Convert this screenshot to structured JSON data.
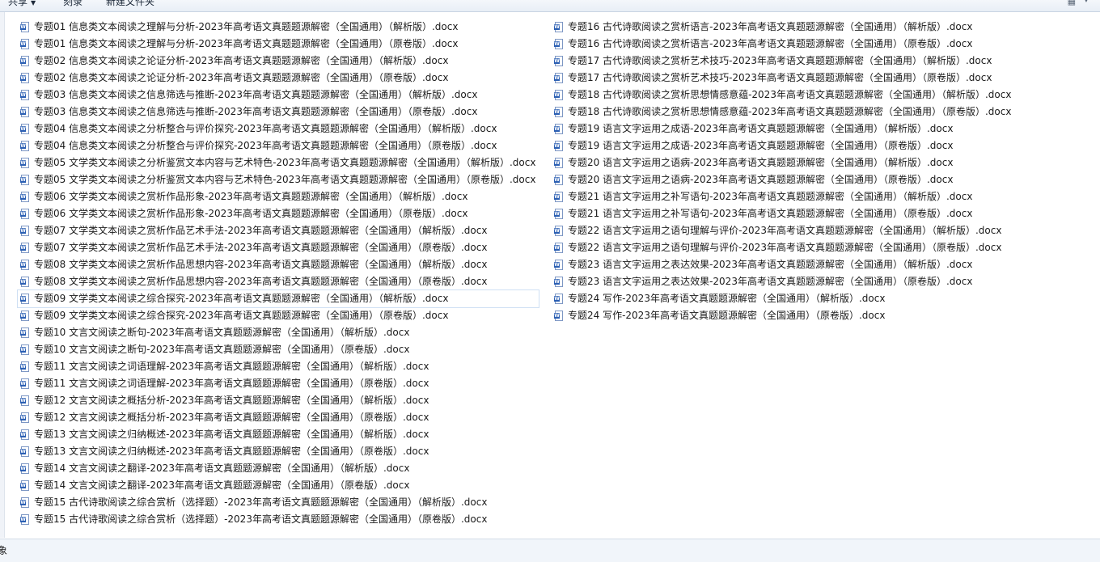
{
  "toolbar": {
    "share_label": "共享",
    "burn_label": "刻录",
    "new_folder_label": "新建文件夹",
    "view_icon": "view-options-icon",
    "view_caret_icon": "chevron-down-icon"
  },
  "file_icon": "word-document-icon",
  "files_left": [
    "专题01 信息类文本阅读之理解与分析-2023年高考语文真题题源解密（全国通用）（解析版）.docx",
    "专题01 信息类文本阅读之理解与分析-2023年高考语文真题题源解密（全国通用）（原卷版）.docx",
    "专题02 信息类文本阅读之论证分析-2023年高考语文真题题源解密（全国通用）（解析版）.docx",
    "专题02 信息类文本阅读之论证分析-2023年高考语文真题题源解密（全国通用）（原卷版）.docx",
    "专题03 信息类文本阅读之信息筛选与推断-2023年高考语文真题题源解密（全国通用）（解析版）.docx",
    "专题03 信息类文本阅读之信息筛选与推断-2023年高考语文真题题源解密（全国通用）（原卷版）.docx",
    "专题04 信息类文本阅读之分析整合与评价探究-2023年高考语文真题题源解密（全国通用）（解析版）.docx",
    "专题04 信息类文本阅读之分析整合与评价探究-2023年高考语文真题题源解密（全国通用）（原卷版）.docx",
    "专题05 文学类文本阅读之分析鉴赏文本内容与艺术特色-2023年高考语文真题题源解密（全国通用）（解析版）.docx",
    "专题05 文学类文本阅读之分析鉴赏文本内容与艺术特色-2023年高考语文真题题源解密（全国通用）（原卷版）.docx",
    "专题06 文学类文本阅读之赏析作品形象-2023年高考语文真题题源解密（全国通用）（解析版）.docx",
    "专题06 文学类文本阅读之赏析作品形象-2023年高考语文真题题源解密（全国通用）（原卷版）.docx",
    "专题07 文学类文本阅读之赏析作品艺术手法-2023年高考语文真题题源解密（全国通用）（解析版）.docx",
    "专题07 文学类文本阅读之赏析作品艺术手法-2023年高考语文真题题源解密（全国通用）（原卷版）.docx",
    "专题08 文学类文本阅读之赏析作品思想内容-2023年高考语文真题题源解密（全国通用）（解析版）.docx",
    "专题08 文学类文本阅读之赏析作品思想内容-2023年高考语文真题题源解密（全国通用）（原卷版）.docx",
    "专题09 文学类文本阅读之综合探究-2023年高考语文真题题源解密（全国通用）（解析版）.docx",
    "专题09 文学类文本阅读之综合探究-2023年高考语文真题题源解密（全国通用）（原卷版）.docx",
    "专题10 文言文阅读之断句-2023年高考语文真题题源解密（全国通用）（解析版）.docx",
    "专题10 文言文阅读之断句-2023年高考语文真题题源解密（全国通用）（原卷版）.docx",
    "专题11 文言文阅读之词语理解-2023年高考语文真题题源解密（全国通用）（解析版）.docx",
    "专题11 文言文阅读之词语理解-2023年高考语文真题题源解密（全国通用）（原卷版）.docx",
    "专题12 文言文阅读之概括分析-2023年高考语文真题题源解密（全国通用）（解析版）.docx",
    "专题12 文言文阅读之概括分析-2023年高考语文真题题源解密（全国通用）（原卷版）.docx",
    "专题13 文言文阅读之归纳概述-2023年高考语文真题题源解密（全国通用）（解析版）.docx",
    "专题13 文言文阅读之归纳概述-2023年高考语文真题题源解密（全国通用）（原卷版）.docx",
    "专题14 文言文阅读之翻译-2023年高考语文真题题源解密（全国通用）（解析版）.docx",
    "专题14 文言文阅读之翻译-2023年高考语文真题题源解密（全国通用）（原卷版）.docx",
    "专题15 古代诗歌阅读之综合赏析（选择题）-2023年高考语文真题题源解密（全国通用）（解析版）.docx",
    "专题15 古代诗歌阅读之综合赏析（选择题）-2023年高考语文真题题源解密（全国通用）（原卷版）.docx"
  ],
  "files_right": [
    "专题16 古代诗歌阅读之赏析语言-2023年高考语文真题题源解密（全国通用）（解析版）.docx",
    "专题16 古代诗歌阅读之赏析语言-2023年高考语文真题题源解密（全国通用）（原卷版）.docx",
    "专题17 古代诗歌阅读之赏析艺术技巧-2023年高考语文真题题源解密（全国通用）（解析版）.docx",
    "专题17 古代诗歌阅读之赏析艺术技巧-2023年高考语文真题题源解密（全国通用）（原卷版）.docx",
    "专题18 古代诗歌阅读之赏析思想情感意蕴-2023年高考语文真题题源解密（全国通用）（解析版）.docx",
    "专题18 古代诗歌阅读之赏析思想情感意蕴-2023年高考语文真题题源解密（全国通用）（原卷版）.docx",
    "专题19 语言文字运用之成语-2023年高考语文真题题源解密（全国通用）（解析版）.docx",
    "专题19 语言文字运用之成语-2023年高考语文真题题源解密（全国通用）（原卷版）.docx",
    "专题20 语言文字运用之语病-2023年高考语文真题题源解密（全国通用）（解析版）.docx",
    "专题20 语言文字运用之语病-2023年高考语文真题题源解密（全国通用）（原卷版）.docx",
    "专题21 语言文字运用之补写语句-2023年高考语文真题题源解密（全国通用）（解析版）.docx",
    "专题21 语言文字运用之补写语句-2023年高考语文真题题源解密（全国通用）（原卷版）.docx",
    "专题22 语言文字运用之语句理解与评价-2023年高考语文真题题源解密（全国通用）（解析版）.docx",
    "专题22 语言文字运用之语句理解与评价-2023年高考语文真题题源解密（全国通用）（原卷版）.docx",
    "专题23 语言文字运用之表达效果-2023年高考语文真题题源解密（全国通用）（解析版）.docx",
    "专题23 语言文字运用之表达效果-2023年高考语文真题题源解密（全国通用）（原卷版）.docx",
    "专题24 写作-2023年高考语文真题题源解密（全国通用）（解析版）.docx",
    "专题24 写作-2023年高考语文真题题源解密（全国通用）（原卷版）.docx"
  ],
  "hovered_left_index": 16,
  "statusbar": {
    "text": "象"
  }
}
